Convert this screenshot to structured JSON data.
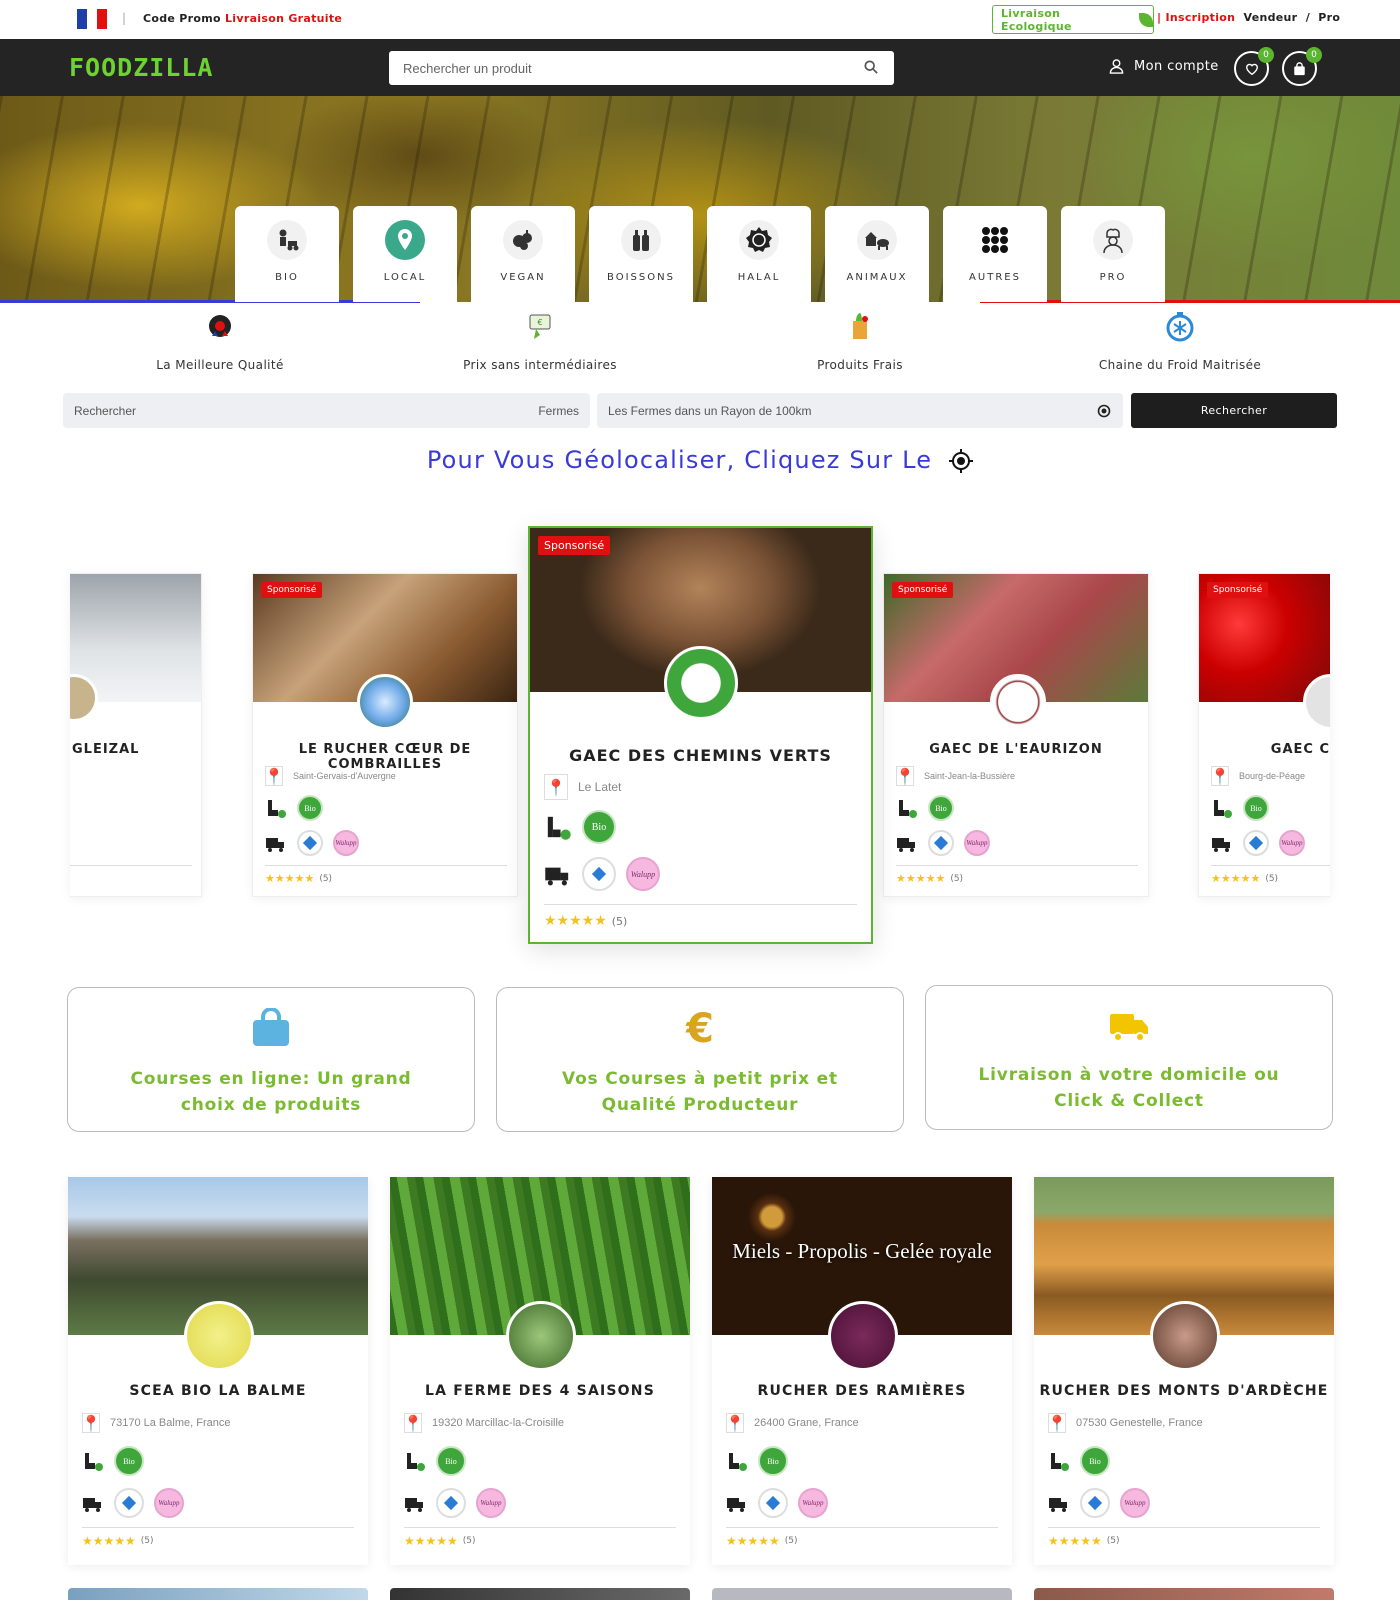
{
  "topbar": {
    "promo_label": "Code Promo",
    "promo_value": "Livraison Gratuite",
    "eco_label": "Livraison Ecologique",
    "inscription": "Inscription",
    "vendeur": "Vendeur",
    "slash": "/",
    "pro": "Pro"
  },
  "navbar": {
    "logo": "FOODZILLA",
    "search_placeholder": "Rechercher un produit",
    "account": "Mon compte",
    "wishlist_count": "0",
    "cart_count": "0"
  },
  "categories": [
    {
      "label": "BIO",
      "icon": "farmer-icon"
    },
    {
      "label": "LOCAL",
      "icon": "map-pin-icon"
    },
    {
      "label": "VEGAN",
      "icon": "vegetables-icon"
    },
    {
      "label": "BOISSONS",
      "icon": "bottles-icon"
    },
    {
      "label": "HALAL",
      "icon": "halal-badge-icon"
    },
    {
      "label": "ANIMAUX",
      "icon": "farm-animals-icon"
    },
    {
      "label": "AUTRES",
      "icon": "grid-dots-icon"
    },
    {
      "label": "PRO",
      "icon": "chef-icon"
    }
  ],
  "values": [
    {
      "label": "La Meilleure Qualité",
      "icon": "quality-medal-icon"
    },
    {
      "label": "Prix sans intermédiaires",
      "icon": "price-tag-icon"
    },
    {
      "label": "Produits Frais",
      "icon": "grocery-bag-icon"
    },
    {
      "label": "Chaine du Froid Maitrisée",
      "icon": "snowflake-stopwatch-icon"
    }
  ],
  "filter": {
    "search_placeholder": "Rechercher",
    "type_value": "Fermes",
    "radius_placeholder": "Les Fermes dans un Rayon de 100km",
    "button": "Rechercher"
  },
  "geoloc_text": "Pour Vous Géolocaliser, Cliquez Sur Le",
  "carousel": [
    {
      "name": "GLEIZAL",
      "location": "",
      "sponsored": false,
      "reviews": ""
    },
    {
      "name": "LE RUCHER CŒUR DE COMBRAILLES",
      "location": "Saint-Gervais-d'Auvergne",
      "sponsored": true,
      "reviews": "(5)"
    },
    {
      "name": "GAEC DES CHEMINS VERTS",
      "location": "Le Latet",
      "sponsored": true,
      "reviews": "(5)"
    },
    {
      "name": "GAEC DE L'EAURIZON",
      "location": "Saint-Jean-la-Bussière",
      "sponsored": true,
      "reviews": "(5)"
    },
    {
      "name": "GAEC C",
      "location": "Bourg-de-Péage",
      "sponsored": true,
      "reviews": "(5)"
    }
  ],
  "sponsored_label": "Sponsorisé",
  "badges": {
    "bio": "Bio",
    "chrono": "chronopost",
    "wal": "Walupp"
  },
  "features": [
    {
      "line1": "Courses en ligne: Un grand",
      "line2": "choix de produits",
      "icon": "shopping-bag-icon",
      "color": "#5db3e0"
    },
    {
      "line1": "Vos Courses à petit prix et",
      "line2": "Qualité Producteur",
      "icon": "euro-icon",
      "color": "#d9a521"
    },
    {
      "line1": "Livraison à votre domicile ou",
      "line2": "Click & Collect",
      "icon": "delivery-truck-icon",
      "color": "#f2c500"
    }
  ],
  "farms": [
    {
      "name": "SCEA BIO LA BALME",
      "location": "73170 La Balme, France",
      "reviews": "(5)",
      "overlay": ""
    },
    {
      "name": "LA FERME DES 4 SAISONS",
      "location": "19320 Marcillac-la-Croisille",
      "reviews": "(5)",
      "overlay": ""
    },
    {
      "name": "RUCHER DES RAMIÈRES",
      "location": "26400 Grane, France",
      "reviews": "(5)",
      "overlay": "Miels - Propolis - Gelée royale"
    },
    {
      "name": "RUCHER DES MONTS D'ARDÈCHE",
      "location": "07530 Genestelle, France",
      "reviews": "(5)",
      "overlay": ""
    }
  ],
  "colors": {
    "accent_green": "#5cb531",
    "brand_green": "#6dd232",
    "feature_text": "#7bbb30",
    "geo_blue": "#3a3ad8",
    "red": "#e01010",
    "dark": "#242424"
  }
}
